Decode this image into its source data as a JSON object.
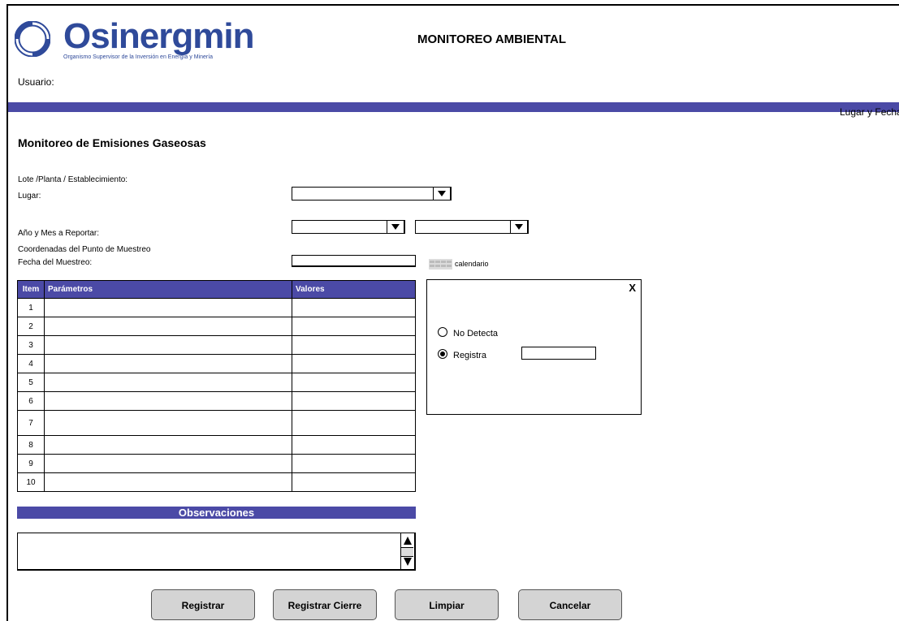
{
  "header": {
    "logo_text": "Osinergmin",
    "logo_subtitle": "Organismo Supervisor de la Inversión en Energía y Minería",
    "title": "MONITOREO AMBIENTAL",
    "user_label": "Usuario:",
    "lugar_fecha": "Lugar y Fecha"
  },
  "colors": {
    "accent": "#4b4aa6",
    "logo": "#2f4a9a"
  },
  "form": {
    "section_title": "Monitoreo de Emisiones Gaseosas",
    "lote_label": "Lote /Planta / Establecimiento:",
    "lugar_label": "Lugar:",
    "anio_mes_label": "Año y Mes a Reportar:",
    "coordenadas_label": "Coordenadas del Punto de Muestreo",
    "fecha_label": "Fecha del Muestreo:",
    "calendario_label": "calendario",
    "lugar_value": "",
    "anio_value": "",
    "mes_value": "",
    "fecha_value": ""
  },
  "table": {
    "headers": {
      "item": "Item",
      "parametros": "Parámetros",
      "valores": "Valores"
    },
    "rows": [
      {
        "item": "1",
        "parametro": "",
        "valor": ""
      },
      {
        "item": "2",
        "parametro": "",
        "valor": ""
      },
      {
        "item": "3",
        "parametro": "",
        "valor": ""
      },
      {
        "item": "4",
        "parametro": "",
        "valor": ""
      },
      {
        "item": "5",
        "parametro": "",
        "valor": ""
      },
      {
        "item": "6",
        "parametro": "",
        "valor": ""
      },
      {
        "item": "7",
        "parametro": "",
        "valor": ""
      },
      {
        "item": "8",
        "parametro": "",
        "valor": ""
      },
      {
        "item": "9",
        "parametro": "",
        "valor": ""
      },
      {
        "item": "10",
        "parametro": "",
        "valor": ""
      }
    ]
  },
  "popup": {
    "close": "X",
    "no_detecta": "No Detecta",
    "registra": "Registra",
    "selected": "registra",
    "registra_value": ""
  },
  "observaciones": {
    "title": "Observaciones",
    "value": ""
  },
  "buttons": {
    "registrar": "Registrar",
    "registrar_cierre": "Registrar Cierre",
    "limpiar": "Limpiar",
    "cancelar": "Cancelar"
  }
}
